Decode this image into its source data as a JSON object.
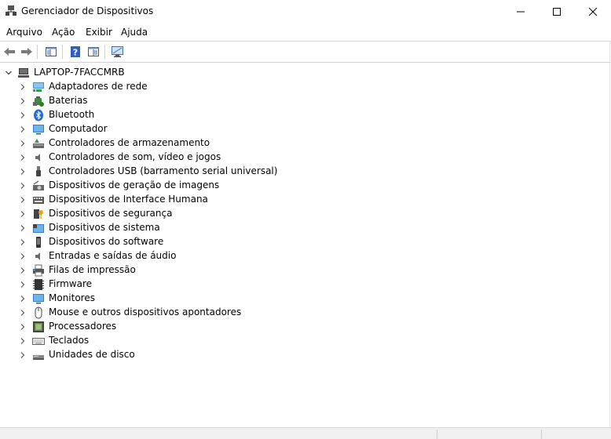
{
  "window": {
    "title": "Gerenciador de Dispositivos",
    "icon": "device-manager-icon"
  },
  "menu": [
    {
      "label": "Arquivo"
    },
    {
      "label": "Ação"
    },
    {
      "label": "Exibir"
    },
    {
      "label": "Ajuda"
    }
  ],
  "toolbar": [
    {
      "name": "back-button",
      "icon": "arrow-left-icon"
    },
    {
      "name": "forward-button",
      "icon": "arrow-right-icon"
    },
    {
      "name": "show-hide-console-tree-button",
      "icon": "console-tree-icon"
    },
    {
      "name": "help-button",
      "icon": "help-icon"
    },
    {
      "name": "properties-view-button",
      "icon": "properties-icon"
    },
    {
      "name": "scan-hardware-button",
      "icon": "monitor-scan-icon"
    }
  ],
  "tree": {
    "root": {
      "label": "LAPTOP-7FACCMRB",
      "icon": "computer-icon",
      "expanded": true
    },
    "items": [
      {
        "label": "Adaptadores de rede",
        "icon": "network-adapter-icon"
      },
      {
        "label": "Baterias",
        "icon": "battery-icon"
      },
      {
        "label": "Bluetooth",
        "icon": "bluetooth-icon"
      },
      {
        "label": "Computador",
        "icon": "computer-monitor-icon"
      },
      {
        "label": "Controladores de armazenamento",
        "icon": "storage-controller-icon"
      },
      {
        "label": "Controladores de som, vídeo e jogos",
        "icon": "speaker-icon"
      },
      {
        "label": "Controladores USB (barramento serial universal)",
        "icon": "usb-icon"
      },
      {
        "label": "Dispositivos de geração de imagens",
        "icon": "camera-icon"
      },
      {
        "label": "Dispositivos de Interface Humana",
        "icon": "hid-icon"
      },
      {
        "label": "Dispositivos de segurança",
        "icon": "security-key-icon"
      },
      {
        "label": "Dispositivos de sistema",
        "icon": "system-folder-icon"
      },
      {
        "label": "Dispositivos do software",
        "icon": "software-device-icon"
      },
      {
        "label": "Entradas e saídas de áudio",
        "icon": "audio-io-icon"
      },
      {
        "label": "Filas de impressão",
        "icon": "printer-icon"
      },
      {
        "label": "Firmware",
        "icon": "chip-icon"
      },
      {
        "label": "Monitores",
        "icon": "monitor-icon"
      },
      {
        "label": "Mouse e outros dispositivos apontadores",
        "icon": "mouse-icon"
      },
      {
        "label": "Processadores",
        "icon": "processor-icon"
      },
      {
        "label": "Teclados",
        "icon": "keyboard-icon"
      },
      {
        "label": "Unidades de disco",
        "icon": "disk-drive-icon"
      }
    ]
  }
}
